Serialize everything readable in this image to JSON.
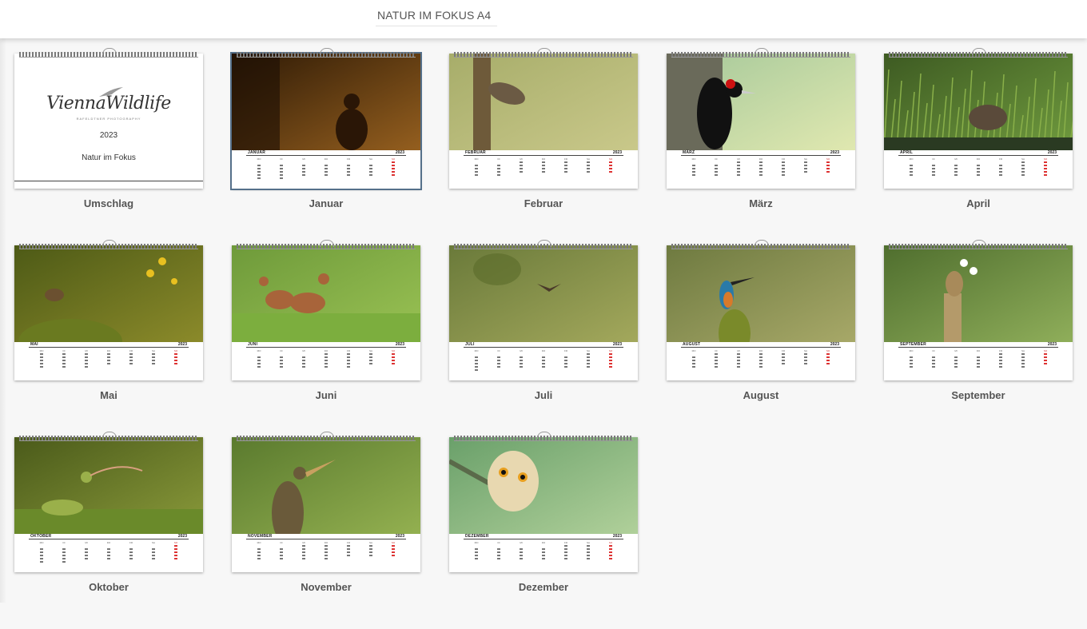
{
  "header": {
    "title": "NATUR IM FOKUS A4"
  },
  "cover": {
    "label": "Umschlag",
    "logo_text": "ViennaWildlife",
    "logo_subtitle": "RAFELDTNER PHOTOGRAPHY",
    "year": "2023",
    "title": "Natur im Fokus"
  },
  "calendar": {
    "year": "2023",
    "weekdays": [
      "MO",
      "DI",
      "MI",
      "DO",
      "FR",
      "SA",
      "SO"
    ]
  },
  "months": [
    {
      "label": "Januar",
      "header": "JANUAR",
      "start": 6,
      "days": 31,
      "selected": true,
      "scene": "silhouette",
      "c1": "#3b2208",
      "c2": "#d68a2e"
    },
    {
      "label": "Februar",
      "header": "FEBRUAR",
      "start": 2,
      "days": 28,
      "scene": "bird",
      "c1": "#a7ad6a",
      "c2": "#c9c88a",
      "c3": "#6e5a3a"
    },
    {
      "label": "März",
      "header": "MÄRZ",
      "start": 2,
      "days": 31,
      "scene": "woodpecker",
      "c1": "#a5c89a",
      "c2": "#e0e8b0",
      "c3": "#111"
    },
    {
      "label": "April",
      "header": "APRIL",
      "start": 5,
      "days": 30,
      "scene": "grass",
      "c1": "#3d5a22",
      "c2": "#6f9a3e",
      "c3": "#5a4a3a"
    },
    {
      "label": "Mai",
      "header": "MAI",
      "start": 0,
      "days": 31,
      "scene": "wren",
      "c1": "#4d5a16",
      "c2": "#8b8a2a",
      "c3": "#6b5030"
    },
    {
      "label": "Juni",
      "header": "JUNI",
      "start": 3,
      "days": 30,
      "scene": "deer",
      "c1": "#6e9a3a",
      "c2": "#9ac254",
      "c3": "#a8643a"
    },
    {
      "label": "Juli",
      "header": "JULI",
      "start": 5,
      "days": 31,
      "scene": "flight",
      "c1": "#6a7a3a",
      "c2": "#a3a85c",
      "c3": "#4a3a2a"
    },
    {
      "label": "August",
      "header": "AUGUST",
      "start": 1,
      "days": 31,
      "scene": "kingfisher",
      "c1": "#6e7a40",
      "c2": "#a7a868",
      "c3": "#2a7aa8"
    },
    {
      "label": "September",
      "header": "SEPTEMBER",
      "start": 4,
      "days": 30,
      "scene": "squirrel",
      "c1": "#4f6e2e",
      "c2": "#8fae5a",
      "c3": "#b49a6a"
    },
    {
      "label": "Oktober",
      "header": "OKTOBER",
      "start": 6,
      "days": 31,
      "scene": "greenpecker",
      "c1": "#4a5a1a",
      "c2": "#8a9a3a",
      "c3": "#9ab04a"
    },
    {
      "label": "November",
      "header": "NOVEMBER",
      "start": 2,
      "days": 30,
      "scene": "bittern",
      "c1": "#5a7a2e",
      "c2": "#93b050",
      "c3": "#6a5a3a"
    },
    {
      "label": "Dezember",
      "header": "DEZEMBER",
      "start": 4,
      "days": 31,
      "scene": "owl",
      "c1": "#6aa06a",
      "c2": "#b0d09a",
      "c3": "#e8d8b0"
    }
  ]
}
